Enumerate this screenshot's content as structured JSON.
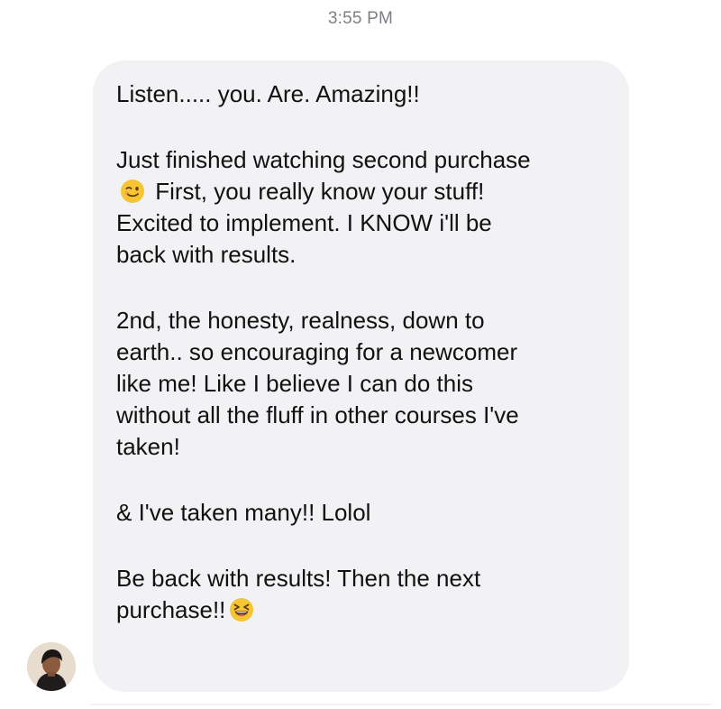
{
  "header": {
    "timestamp": "3:55 PM"
  },
  "message": {
    "paragraphs": [
      [
        "Listen..... you. Are. Amazing!!"
      ],
      [
        "Just finished watching second purchase",
        " First, you really know your stuff!",
        "Excited to implement. I KNOW i'll be",
        "back with results."
      ],
      [
        "2nd, the honesty, realness, down to",
        "earth.. so encouraging for a newcomer",
        "like me! Like I believe I can do this",
        "without all the fluff in other courses I've",
        "taken!"
      ],
      [
        "& I've taken many!! Lolol"
      ],
      [
        "Be back with results!  Then the next",
        "purchase!!"
      ]
    ],
    "emoji": {
      "wink": "winking-face",
      "laugh": "grinning-squinting-face"
    }
  },
  "sender": {
    "avatar": "profile-photo"
  },
  "colors": {
    "bubble": "#f2f2f4",
    "timestamp": "#7f7f84",
    "text": "#111111",
    "emoji": "#f7c531"
  }
}
